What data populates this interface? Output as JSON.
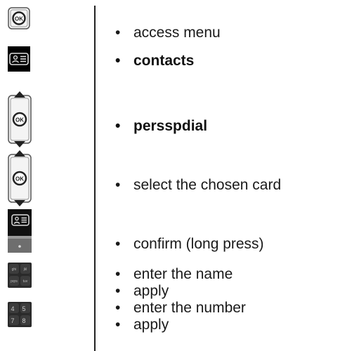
{
  "steps": [
    {
      "text": "access menu"
    },
    {
      "text": "contacts"
    },
    {
      "text": "persspdial"
    },
    {
      "text": "select the chosen card"
    },
    {
      "text": "confirm (long press)"
    },
    {
      "text": "enter the name"
    },
    {
      "text": "apply"
    },
    {
      "text": "enter the number"
    },
    {
      "text": "apply"
    }
  ],
  "bullet": "•",
  "keypad_name_keys": [
    "ghi",
    "jkl",
    "pqrs",
    "tuv"
  ],
  "keypad_number_keys": [
    "4",
    "5",
    "7",
    "8"
  ]
}
